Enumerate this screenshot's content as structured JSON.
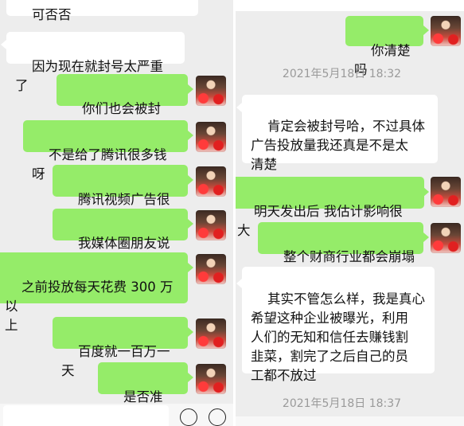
{
  "left": {
    "partial_top_text": "可否否",
    "messages": [
      {
        "side": "in",
        "text": "因为现在就封号太严重了"
      },
      {
        "side": "out",
        "text": "你们也会被封号?"
      },
      {
        "side": "out",
        "text": "不是给了腾讯很多钱呀"
      },
      {
        "side": "out",
        "text": "腾讯视频广告很多"
      },
      {
        "side": "out",
        "text": "我媒体圈朋友说了"
      },
      {
        "side": "out",
        "text": "之前投放每天花费 300 万以\n上"
      },
      {
        "side": "out",
        "text": "百度就一百万一天"
      },
      {
        "side": "out",
        "text": "是否准确?"
      }
    ]
  },
  "right": {
    "messages": [
      {
        "side": "out",
        "text": "你清楚吗"
      },
      {
        "side": "in",
        "text": "肯定会被封号哈，不过具体\n广告投放量我还真是不是太\n清楚"
      },
      {
        "side": "out",
        "text": "明天发出后 我估计影响很大"
      },
      {
        "side": "out",
        "text": "整个财商行业都会崩塌"
      },
      {
        "side": "in",
        "text": "其实不管怎么样，我是真心\n希望这种企业被曝光，利用\n人们的无知和信任去赚钱割\n韭菜，割完了之后自己的员\n工都不放过"
      }
    ],
    "timestamps": [
      "2021年5月18日 18:32",
      "2021年5月18日 18:37"
    ]
  },
  "icons": {
    "left_avatar": "user-avatar-icon",
    "emoji": "emoji-icon",
    "add": "plus-icon"
  },
  "colors": {
    "outgoing_bubble": "#95ec69",
    "incoming_bubble": "#ffffff",
    "chat_background": "#ededed",
    "timestamp_text": "#9a9a9a"
  }
}
